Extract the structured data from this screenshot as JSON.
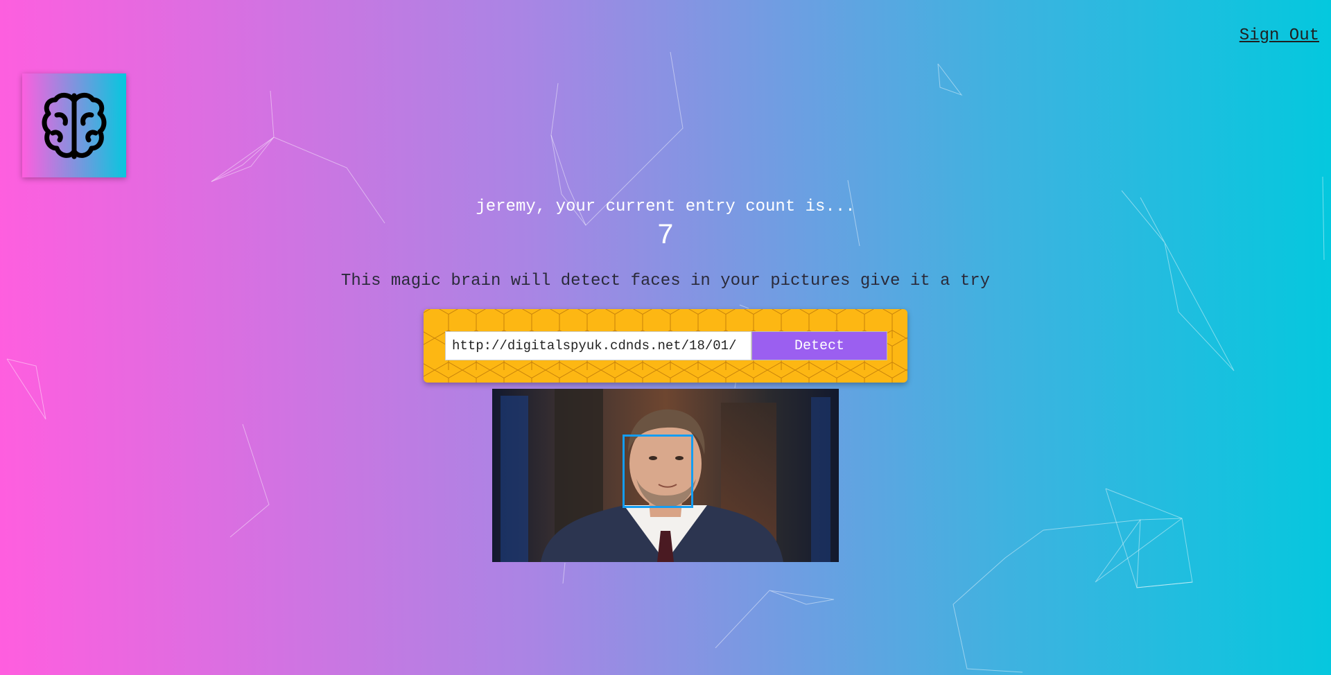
{
  "nav": {
    "sign_out_label": "Sign Out"
  },
  "logo": {
    "icon": "brain-icon"
  },
  "rank": {
    "name_line": "jeremy, your current entry count is...",
    "count": "7"
  },
  "tagline": "This magic brain will detect faces in your pictures give it a try",
  "form": {
    "input_value": "http://digitalspyuk.cdnds.net/18/01/",
    "button_label": "Detect"
  },
  "face_recognition": {
    "faces_detected": 1
  },
  "colors": {
    "accent_purple": "#9b5ff0",
    "form_bg": "#fdb713",
    "face_box": "#149df2",
    "gradient_start": "#ff5edf",
    "gradient_end": "#04c8de"
  }
}
